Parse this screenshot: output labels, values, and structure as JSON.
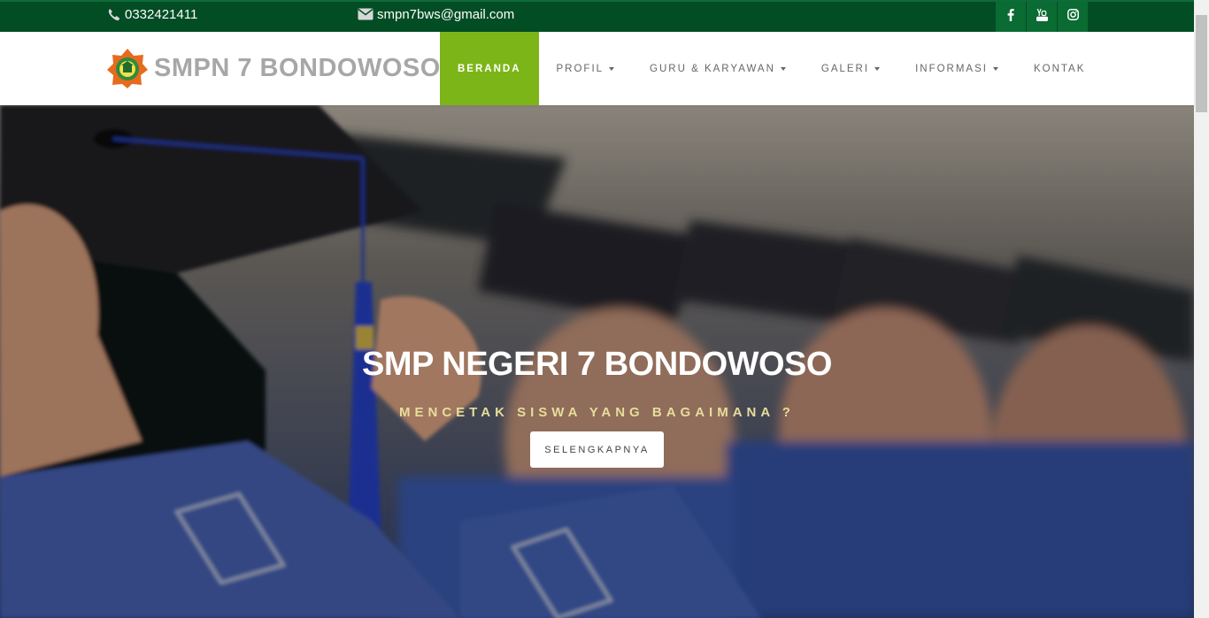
{
  "topbar": {
    "phone": "0332421411",
    "email": "smpn7bws@gmail.com",
    "social_icons": [
      "facebook-icon",
      "youtube-icon",
      "instagram-icon"
    ]
  },
  "navbar": {
    "brand": "SMPN 7 BONDOWOSO",
    "items": [
      {
        "label": "BERANDA",
        "active": true,
        "dropdown": false
      },
      {
        "label": "PROFIL",
        "active": false,
        "dropdown": true
      },
      {
        "label": "GURU & KARYAWAN",
        "active": false,
        "dropdown": true
      },
      {
        "label": "GALERI",
        "active": false,
        "dropdown": true
      },
      {
        "label": "INFORMASI",
        "active": false,
        "dropdown": true
      },
      {
        "label": "KONTAK",
        "active": false,
        "dropdown": false
      }
    ]
  },
  "hero": {
    "title": "SMP NEGERI 7 BONDOWOSO",
    "subtitle": "MENCETAK SISWA YANG BAGAIMANA ?",
    "button": "SELENGKAPNYA"
  },
  "colors": {
    "topbar": "#034d25",
    "social_button": "#0a6b33",
    "nav_active": "#7cb518",
    "subtitle": "#e6dd9a"
  }
}
